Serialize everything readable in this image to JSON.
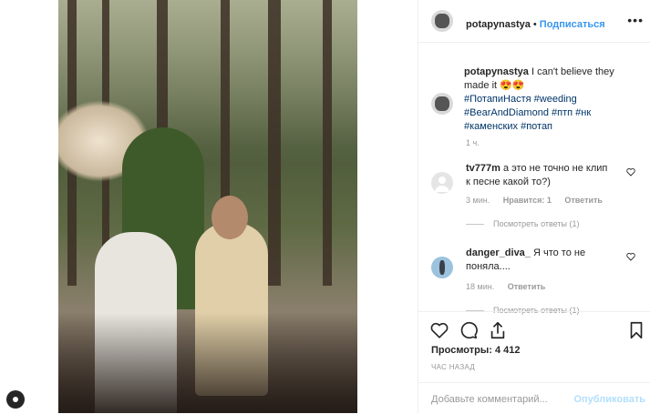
{
  "colors": {
    "link": "#3897f0",
    "hashtag": "#003569",
    "muted": "#999999",
    "text": "#262626",
    "publish_disabled": "#b2dffc"
  },
  "header": {
    "username": "potapynastya",
    "separator": "•",
    "follow_label": "Подписаться",
    "more_icon": "ellipsis-icon"
  },
  "caption": {
    "username": "potapynastya",
    "text": "I can't believe they made it 😍😍",
    "hashtags": [
      "#ПотапиНастя",
      "#weeding",
      "#BearAndDiamond",
      "#птп",
      "#нк",
      "#каменских",
      "#потап"
    ],
    "time": "1 ч."
  },
  "comments": [
    {
      "username": "tv777m",
      "text": "а это не точно не клип к песне какой то?)",
      "time": "3 мин.",
      "likes": "Нравится: 1",
      "reply": "Ответить",
      "view_replies": "Посмотреть ответы (1)"
    },
    {
      "username": "danger_diva_",
      "text": "Я что то не поняла....",
      "time": "18 мин.",
      "reply": "Ответить",
      "view_replies": "Посмотреть ответы (1)"
    }
  ],
  "actions": {
    "icons": [
      "heart-icon",
      "comment-icon",
      "share-icon",
      "bookmark-icon"
    ]
  },
  "stats": {
    "views": "Просмотры: 4 412",
    "posted": "ЧАС НАЗАД"
  },
  "comment_box": {
    "placeholder": "Добавьте комментарий...",
    "publish_label": "Опубликовать"
  }
}
